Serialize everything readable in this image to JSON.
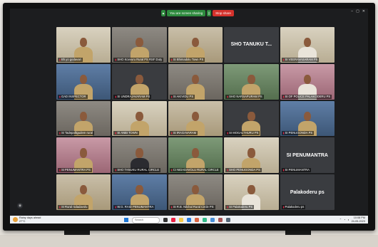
{
  "share_bar": {
    "status": "You are screen sharing",
    "stop_label": "Stop share"
  },
  "tiles": [
    {
      "label": "Bh.yo godavari",
      "name": "",
      "bg": "bg-cream",
      "uniform": "khaki"
    },
    {
      "label": "SHO Kovvuru Rural PS RSF Duty",
      "name": "",
      "bg": "bg-office",
      "uniform": "khaki"
    },
    {
      "label": "SI Bhimadolu Town PS",
      "name": "",
      "bg": "bg-wall",
      "uniform": "khaki"
    },
    {
      "label": "",
      "name": "SHO TANUKU T...",
      "bg": "bg-plain",
      "uniform": ""
    },
    {
      "label": "SI VEERAVASARAM PS",
      "name": "",
      "bg": "bg-cream",
      "uniform": "white"
    },
    {
      "label": "GAD INSPECTOR",
      "name": "",
      "bg": "bg-blue",
      "uniform": "khaki"
    },
    {
      "label": "SI UNDRAJAVARAM PS",
      "name": "",
      "bg": "bg-plain",
      "uniform": "khaki"
    },
    {
      "label": "SI AKIVIDU PS",
      "name": "",
      "bg": "bg-office",
      "uniform": "khaki"
    },
    {
      "label": "SHO NARSAPURAM PS",
      "name": "",
      "bg": "bg-green",
      "uniform": "khaki"
    },
    {
      "label": "SI OF POLICE PALAKODERU PS",
      "name": "",
      "bg": "bg-pink",
      "uniform": "white"
    },
    {
      "label": "SI Tadepalligudem rural",
      "name": "",
      "bg": "bg-office",
      "uniform": "khaki"
    },
    {
      "label": "SI ANBI TOWN",
      "name": "",
      "bg": "bg-cream",
      "uniform": "khaki"
    },
    {
      "label": "SI IRAGAVARAM",
      "name": "",
      "bg": "bg-wall",
      "uniform": "khaki"
    },
    {
      "label": "SI MOGALTHURU PS",
      "name": "",
      "bg": "bg-plain",
      "uniform": "khaki"
    },
    {
      "label": "SI PENUGONDA PS",
      "name": "",
      "bg": "bg-blue",
      "uniform": "khaki"
    },
    {
      "label": "SI PENUMANTRA PS",
      "name": "",
      "bg": "bg-pink",
      "uniform": "khaki"
    },
    {
      "label": "SHO TANUKU RURAL CIRCLE",
      "name": "",
      "bg": "bg-office",
      "uniform": "dark"
    },
    {
      "label": "CI NIDADAVOLU RURAL CIRCLE",
      "name": "",
      "bg": "bg-green",
      "uniform": "khaki"
    },
    {
      "label": "SHO PENUGONDA PS",
      "name": "",
      "bg": "bg-cream",
      "uniform": "khaki"
    },
    {
      "label": "SI PENUMANTRA",
      "name": "SI PENUMANTRA",
      "bg": "bg-plain",
      "uniform": ""
    },
    {
      "label": "SI Rural nidadavolu",
      "name": "",
      "bg": "bg-wall",
      "uniform": "khaki"
    },
    {
      "label": "W.G. RAID PENUMANTRA",
      "name": "",
      "bg": "bg-blue",
      "uniform": "khaki"
    },
    {
      "label": "SI R.B. Nilchal Rural Circle PS",
      "name": "",
      "bg": "bg-office",
      "uniform": "khaki"
    },
    {
      "label": "SI Palakoderu PS",
      "name": "",
      "bg": "bg-cream",
      "uniform": "white"
    },
    {
      "label": "Palakoderu ps",
      "name": "Palakoderu ps",
      "bg": "bg-plain",
      "uniform": ""
    }
  ],
  "taskbar": {
    "weather_line1": "Rainy days ahead",
    "weather_line2": "27°C",
    "search_placeholder": "Search",
    "time": "10:08 PM",
    "date": "24-05-2023"
  }
}
